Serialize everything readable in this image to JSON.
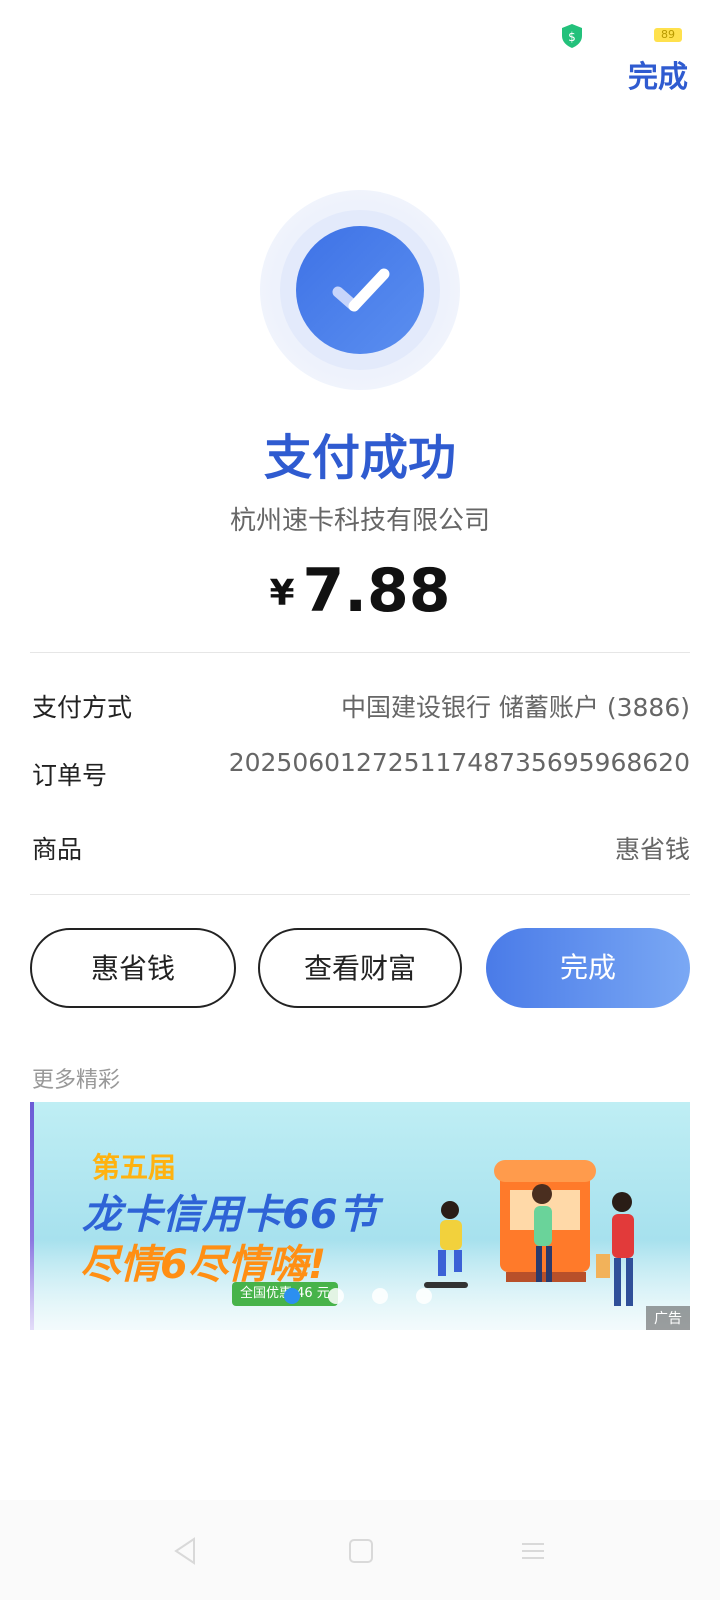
{
  "status_bar": {
    "battery": "89"
  },
  "header": {
    "done_label": "完成"
  },
  "result": {
    "title": "支付成功",
    "merchant": "杭州速卡科技有限公司",
    "currency": "¥",
    "amount": "7.88"
  },
  "details": [
    {
      "label": "支付方式",
      "value": "中国建设银行 储蓄账户 (3886)"
    },
    {
      "label": "订单号",
      "value": "2025060127251174873569596862​0"
    },
    {
      "label": "商品",
      "value": "惠省钱"
    }
  ],
  "actions": {
    "btn1": "惠省钱",
    "btn2": "查看财富",
    "btn3": "完成"
  },
  "more": {
    "label": "更多精彩"
  },
  "banner": {
    "line1": "第五届",
    "line2": "龙卡信用卡66节",
    "line3": "尽情6尽情嗨!",
    "badge": "全国优惠 46 元",
    "ad_label": "广告",
    "active_dot": 0,
    "dot_count": 4
  },
  "colors": {
    "accent": "#2f5bd0",
    "primary_button": "#4a7be8"
  }
}
